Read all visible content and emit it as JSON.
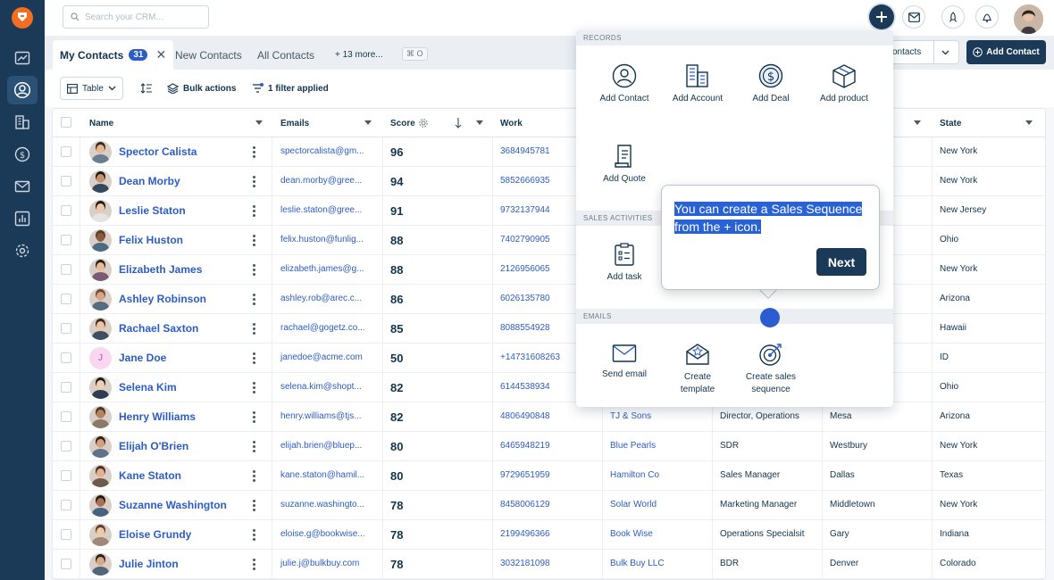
{
  "search": {
    "placeholder": "Search your CRM..."
  },
  "tabs": [
    {
      "label": "My Contacts",
      "count": "31"
    },
    {
      "label": "New Contacts"
    },
    {
      "label": "All Contacts"
    },
    {
      "label": "+ 13 more..."
    }
  ],
  "shortcut": "⌘ O",
  "view_dropdown_label": "ontacts",
  "add_contact_label": "Add Contact",
  "toolbar": {
    "table_label": "Table",
    "bulk_label": "Bulk actions",
    "filter_label": "1 filter applied"
  },
  "columns": {
    "name": "Name",
    "emails": "Emails",
    "score": "Score",
    "work": "Work",
    "state": "State"
  },
  "rows": [
    {
      "name": "Spector Calista",
      "email": "spectorcalista@gm...",
      "score": "96",
      "work": "3684945781",
      "company": "",
      "title": "",
      "city": "",
      "state": "New York"
    },
    {
      "name": "Dean Morby",
      "email": "dean.morby@gree...",
      "score": "94",
      "work": "5852666935",
      "company": "",
      "title": "",
      "city": "",
      "state": "New York"
    },
    {
      "name": "Leslie Staton",
      "email": "leslie.staton@gree...",
      "score": "91",
      "work": "9732137944",
      "company": "",
      "title": "",
      "city": "",
      "state": "New Jersey"
    },
    {
      "name": "Felix Huston",
      "email": "felix.huston@funlig...",
      "score": "88",
      "work": "7402790905",
      "company": "",
      "title": "",
      "city": "",
      "state": "Ohio"
    },
    {
      "name": "Elizabeth James",
      "email": "elizabeth.james@g...",
      "score": "88",
      "work": "2126956065",
      "company": "",
      "title": "",
      "city": "",
      "state": "New York"
    },
    {
      "name": "Ashley Robinson",
      "email": "ashley.rob@arec.c...",
      "score": "86",
      "work": "6026135780",
      "company": "",
      "title": "",
      "city": "",
      "state": "Arizona"
    },
    {
      "name": "Rachael Saxton",
      "email": "rachael@gogetz.co...",
      "score": "85",
      "work": "8088554928",
      "company": "",
      "title": "",
      "city": "",
      "state": "Hawaii"
    },
    {
      "name": "Jane Doe",
      "email": "janedoe@acme.com",
      "score": "50",
      "work": "+14731608263",
      "company": "",
      "title": "",
      "city": "",
      "state": "ID",
      "initial": "J"
    },
    {
      "name": "Selena Kim",
      "email": "selena.kim@shopt...",
      "score": "82",
      "work": "6144538934",
      "company": "",
      "title": "",
      "city": "",
      "state": "Ohio"
    },
    {
      "name": "Henry Williams",
      "email": "henry.williams@tjs...",
      "score": "82",
      "work": "4806490848",
      "company": "TJ & Sons",
      "title": "Director, Operations",
      "city": "Mesa",
      "state": "Arizona"
    },
    {
      "name": "Elijah O'Brien",
      "email": "elijah.brien@bluep...",
      "score": "80",
      "work": "6465948219",
      "company": "Blue Pearls",
      "title": "SDR",
      "city": "Westbury",
      "state": "New York"
    },
    {
      "name": "Kane Staton",
      "email": "kane.staton@hamil...",
      "score": "80",
      "work": "9729651959",
      "company": "Hamilton Co",
      "title": "Sales Manager",
      "city": "Dallas",
      "state": "Texas"
    },
    {
      "name": "Suzanne Washington",
      "email": "suzanne.washingto...",
      "score": "78",
      "work": "8458006129",
      "company": "Solar World",
      "title": "Marketing Manager",
      "city": "Middletown",
      "state": "New York"
    },
    {
      "name": "Eloise Grundy",
      "email": "eloise.g@bookwise...",
      "score": "78",
      "work": "2199496366",
      "company": "Book Wise",
      "title": "Operations Specialsit",
      "city": "Gary",
      "state": "Indiana"
    },
    {
      "name": "Julie Jinton",
      "email": "julie.j@bulkbuy.com",
      "score": "78",
      "work": "3032181098",
      "company": "Bulk Buy LLC",
      "title": "BDR",
      "city": "Denver",
      "state": "Colorado"
    }
  ],
  "menu": {
    "records_label": "RECORDS",
    "sales_label": "SALES ACTIVITIES",
    "emails_label": "EMAILS",
    "add_contact": "Add Contact",
    "add_account": "Add Account",
    "add_deal": "Add Deal",
    "add_product": "Add product",
    "add_quote": "Add Quote",
    "add_task": "Add task",
    "send_email": "Send email",
    "create_template_1": "Create",
    "create_template_2": "template",
    "create_sequence_1": "Create sales",
    "create_sequence_2": "sequence"
  },
  "tooltip": {
    "line1": "You can create a Sales Sequence",
    "line2": "from the + icon.",
    "next_label": "Next"
  },
  "colors": {
    "rail": "#1b3a57",
    "link": "#2c5cc5",
    "highlight": "#2862d4",
    "logo": "#f26f21"
  }
}
